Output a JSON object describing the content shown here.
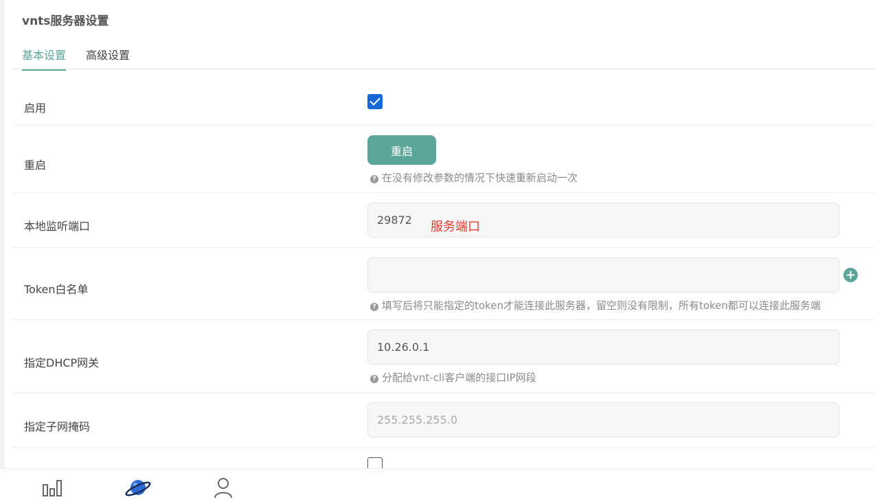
{
  "page": {
    "title": "vnts服务器设置"
  },
  "tabs": [
    {
      "label": "基本设置",
      "active": true
    },
    {
      "label": "高级设置",
      "active": false
    }
  ],
  "form": {
    "enable": {
      "label": "启用",
      "checked": true
    },
    "restart": {
      "label": "重启",
      "button_label": "重启",
      "hint": "在没有修改参数的情况下快速重新启动一次"
    },
    "port": {
      "label": "本地监听端口",
      "value": "29872",
      "annotation": "服务端口"
    },
    "token": {
      "label": "Token白名单",
      "value": "",
      "hint": "填写后将只能指定的token才能连接此服务器，留空则没有限制，所有token都可以连接此服务端"
    },
    "gateway": {
      "label": "指定DHCP网关",
      "value": "10.26.0.1",
      "hint": "分配给vnt-cli客户端的接口IP网段"
    },
    "netmask": {
      "label": "指定子网掩码",
      "placeholder": "255.255.255.0"
    },
    "next_option": {
      "checked": false
    }
  },
  "bottom_nav": [
    {
      "icon": "bar-chart-icon"
    },
    {
      "icon": "planet-icon"
    },
    {
      "icon": "user-icon"
    }
  ],
  "colors": {
    "accent": "#5ba59a",
    "checkbox": "#1668d9",
    "annotation": "#e8392c"
  }
}
